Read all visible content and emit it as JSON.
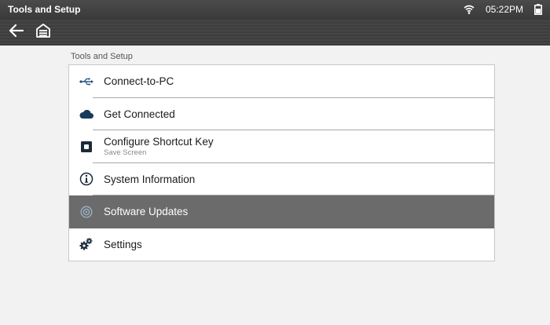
{
  "status_bar": {
    "title": "Tools and Setup",
    "time": "05:22PM",
    "wifi_icon": "wifi-icon",
    "battery_icon": "battery-icon"
  },
  "nav_bar": {
    "back_icon": "arrow-left-icon",
    "home_icon": "garage-home-icon"
  },
  "section_label": "Tools and Setup",
  "menu": {
    "selected_index": 4,
    "items": [
      {
        "label": "Connect-to-PC",
        "sublabel": "",
        "icon": "usb-icon"
      },
      {
        "label": "Get Connected",
        "sublabel": "",
        "icon": "cloud-icon"
      },
      {
        "label": "Configure Shortcut Key",
        "sublabel": "Save Screen",
        "icon": "shortcut-key-icon"
      },
      {
        "label": "System Information",
        "sublabel": "",
        "icon": "info-icon"
      },
      {
        "label": "Software Updates",
        "sublabel": "",
        "icon": "software-update-icon"
      },
      {
        "label": "Settings",
        "sublabel": "",
        "icon": "gears-icon"
      }
    ]
  },
  "colors": {
    "status_bar_bg": "#3a3a3a",
    "selected_row_bg": "#6b6b6b",
    "page_bg": "#f2f2f2"
  }
}
